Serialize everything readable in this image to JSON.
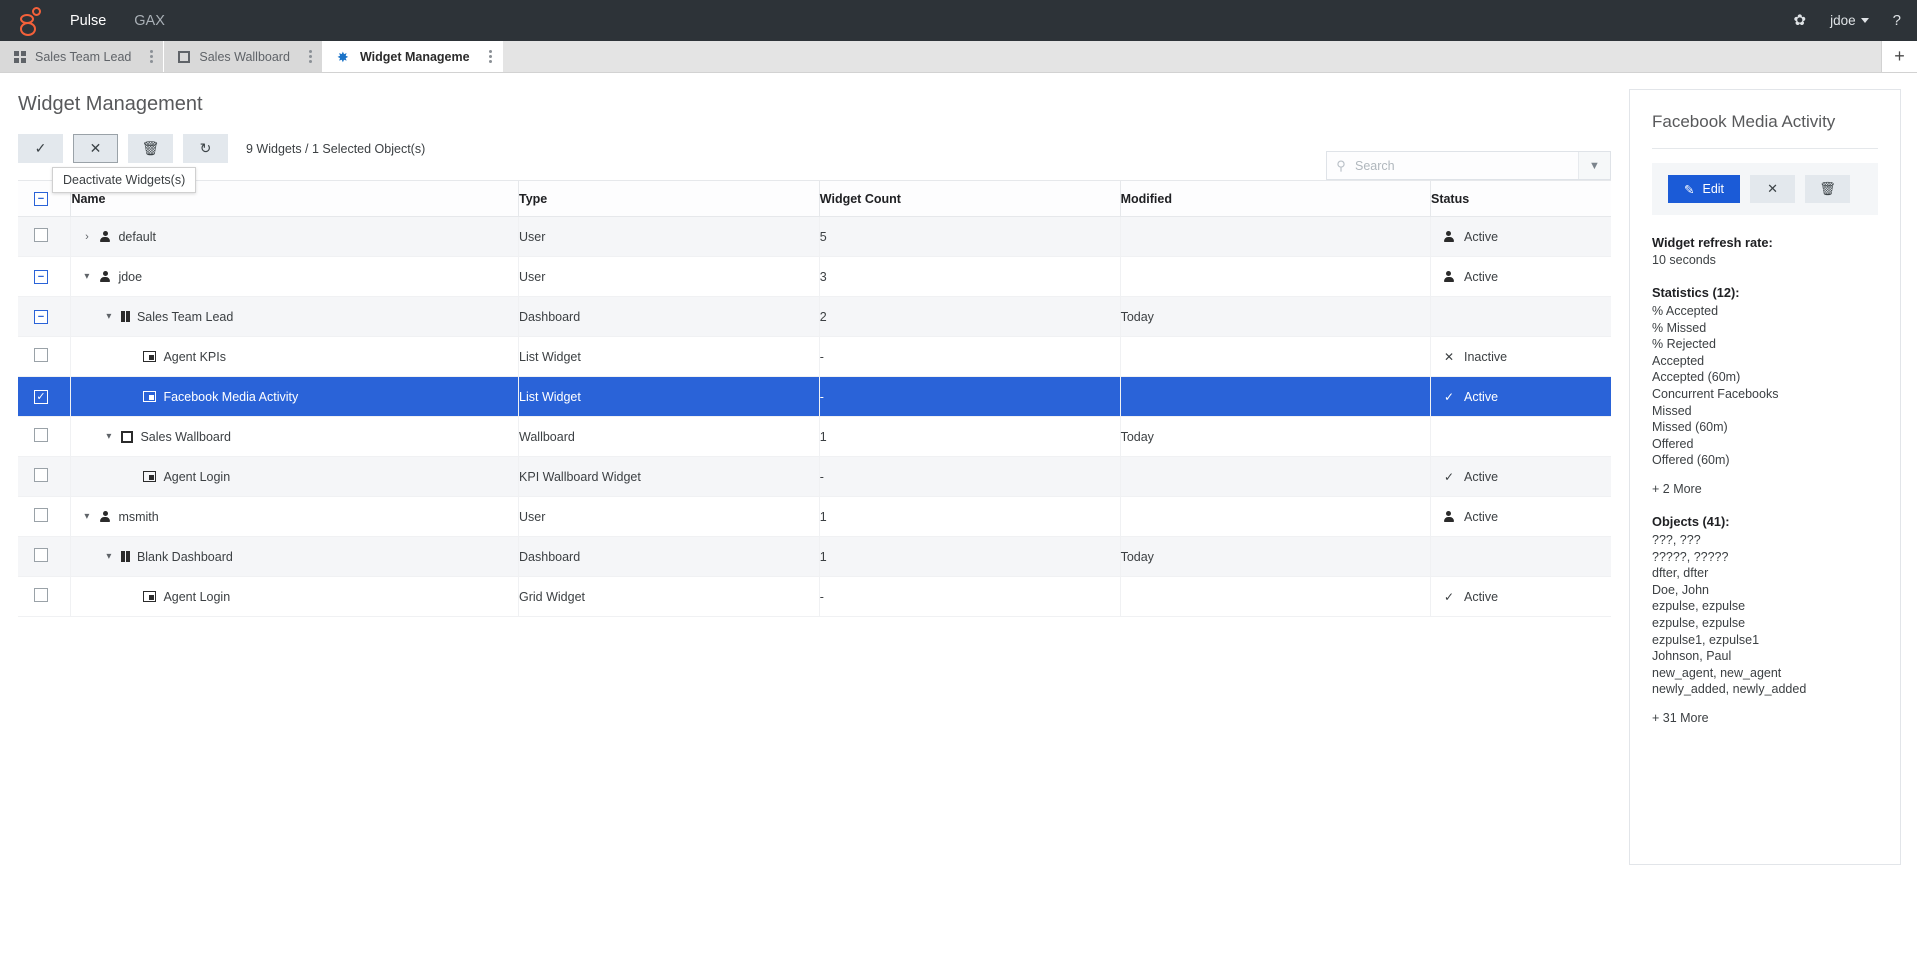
{
  "topbar": {
    "logo_name": "genesys-logo",
    "links": [
      {
        "label": "Pulse",
        "active": true
      },
      {
        "label": "GAX",
        "active": false
      }
    ],
    "gear_icon": "✿",
    "user": "jdoe",
    "help_icon": "?"
  },
  "tabs": [
    {
      "label": "Sales Team Lead",
      "icon": "grid-icon",
      "active": false
    },
    {
      "label": "Sales Wallboard",
      "icon": "square-icon",
      "active": false
    },
    {
      "label": "Widget Manageme",
      "icon": "gear-icon",
      "active": true
    }
  ],
  "tab_add_label": "+",
  "page": {
    "title": "Widget Management"
  },
  "toolbar": {
    "activate_icon": "✓",
    "deactivate_icon": "✕",
    "delete_icon": "🗑",
    "refresh_icon": "↻",
    "count_text": "9 Widgets / 1 Selected Object(s)",
    "tooltip": "Deactivate Widgets(s)"
  },
  "search": {
    "placeholder": "Search",
    "value": "",
    "icon": "search-icon",
    "dropdown_icon": "chevron-down-icon"
  },
  "table": {
    "columns": [
      "Name",
      "Type",
      "Widget Count",
      "Modified",
      "Status"
    ],
    "header_checkbox": "minus",
    "rows": [
      {
        "checkbox": "empty",
        "twisty": "right",
        "indent": 0,
        "icon": "user-icon",
        "name": "default",
        "type": "User",
        "count": "5",
        "modified": "",
        "status_icon": "user-icon",
        "status": "Active",
        "alt": true,
        "selected": false
      },
      {
        "checkbox": "minus",
        "twisty": "down",
        "indent": 0,
        "icon": "user-icon",
        "name": "jdoe",
        "type": "User",
        "count": "3",
        "modified": "",
        "status_icon": "user-icon",
        "status": "Active",
        "alt": false,
        "selected": false
      },
      {
        "checkbox": "minus",
        "twisty": "down",
        "indent": 1,
        "icon": "dashboard-icon",
        "name": "Sales Team Lead",
        "type": "Dashboard",
        "count": "2",
        "modified": "Today",
        "status_icon": "",
        "status": "",
        "alt": true,
        "selected": false
      },
      {
        "checkbox": "empty",
        "twisty": "none",
        "indent": 2,
        "icon": "widget-icon",
        "name": "Agent KPIs",
        "type": "List Widget",
        "count": "-",
        "modified": "",
        "status_icon": "cross",
        "status": "Inactive",
        "alt": false,
        "selected": false
      },
      {
        "checkbox": "checked",
        "twisty": "none",
        "indent": 2,
        "icon": "widget-icon",
        "name": "Facebook Media Activity",
        "type": "List Widget",
        "count": "-",
        "modified": "",
        "status_icon": "check",
        "status": "Active",
        "alt": false,
        "selected": true
      },
      {
        "checkbox": "empty",
        "twisty": "down",
        "indent": 1,
        "icon": "wallboard-icon",
        "name": "Sales Wallboard",
        "type": "Wallboard",
        "count": "1",
        "modified": "Today",
        "status_icon": "",
        "status": "",
        "alt": false,
        "selected": false
      },
      {
        "checkbox": "empty",
        "twisty": "none",
        "indent": 2,
        "icon": "widget-icon",
        "name": "Agent Login",
        "type": "KPI Wallboard Widget",
        "count": "-",
        "modified": "",
        "status_icon": "check",
        "status": "Active",
        "alt": true,
        "selected": false
      },
      {
        "checkbox": "empty",
        "twisty": "down",
        "indent": 0,
        "icon": "user-icon",
        "name": "msmith",
        "type": "User",
        "count": "1",
        "modified": "",
        "status_icon": "user-icon",
        "status": "Active",
        "alt": false,
        "selected": false
      },
      {
        "checkbox": "empty",
        "twisty": "down",
        "indent": 1,
        "icon": "dashboard-icon",
        "name": "Blank Dashboard",
        "type": "Dashboard",
        "count": "1",
        "modified": "Today",
        "status_icon": "",
        "status": "",
        "alt": true,
        "selected": false
      },
      {
        "checkbox": "empty",
        "twisty": "none",
        "indent": 2,
        "icon": "widget-icon",
        "name": "Agent Login",
        "type": "Grid Widget",
        "count": "-",
        "modified": "",
        "status_icon": "check",
        "status": "Active",
        "alt": false,
        "selected": false
      }
    ]
  },
  "detail": {
    "title": "Facebook Media Activity",
    "edit_label": "Edit",
    "edit_icon": "pencil-icon",
    "deactivate_icon": "✕",
    "delete_icon": "🗑",
    "refresh_label": "Widget refresh rate:",
    "refresh_value": "10 seconds",
    "statistics_label": "Statistics (12):",
    "statistics": [
      "% Accepted",
      "% Missed",
      "% Rejected",
      "Accepted",
      "Accepted (60m)",
      "Concurrent Facebooks",
      "Missed",
      "Missed (60m)",
      "Offered",
      "Offered (60m)"
    ],
    "statistics_more": "+ 2 More",
    "objects_label": "Objects (41):",
    "objects": [
      "???, ???",
      "?????, ?????",
      "dfter, dfter",
      "Doe, John",
      "ezpulse, ezpulse",
      "ezpulse, ezpulse",
      "ezpulse1, ezpulse1",
      "Johnson, Paul",
      "new_agent, new_agent",
      "newly_added, newly_added"
    ],
    "objects_more": "+ 31 More"
  },
  "colors": {
    "topbar_bg": "#2d3338",
    "accent": "#2a63d8",
    "brand": "#f4613a",
    "edit_blue": "#1b5bd7"
  }
}
